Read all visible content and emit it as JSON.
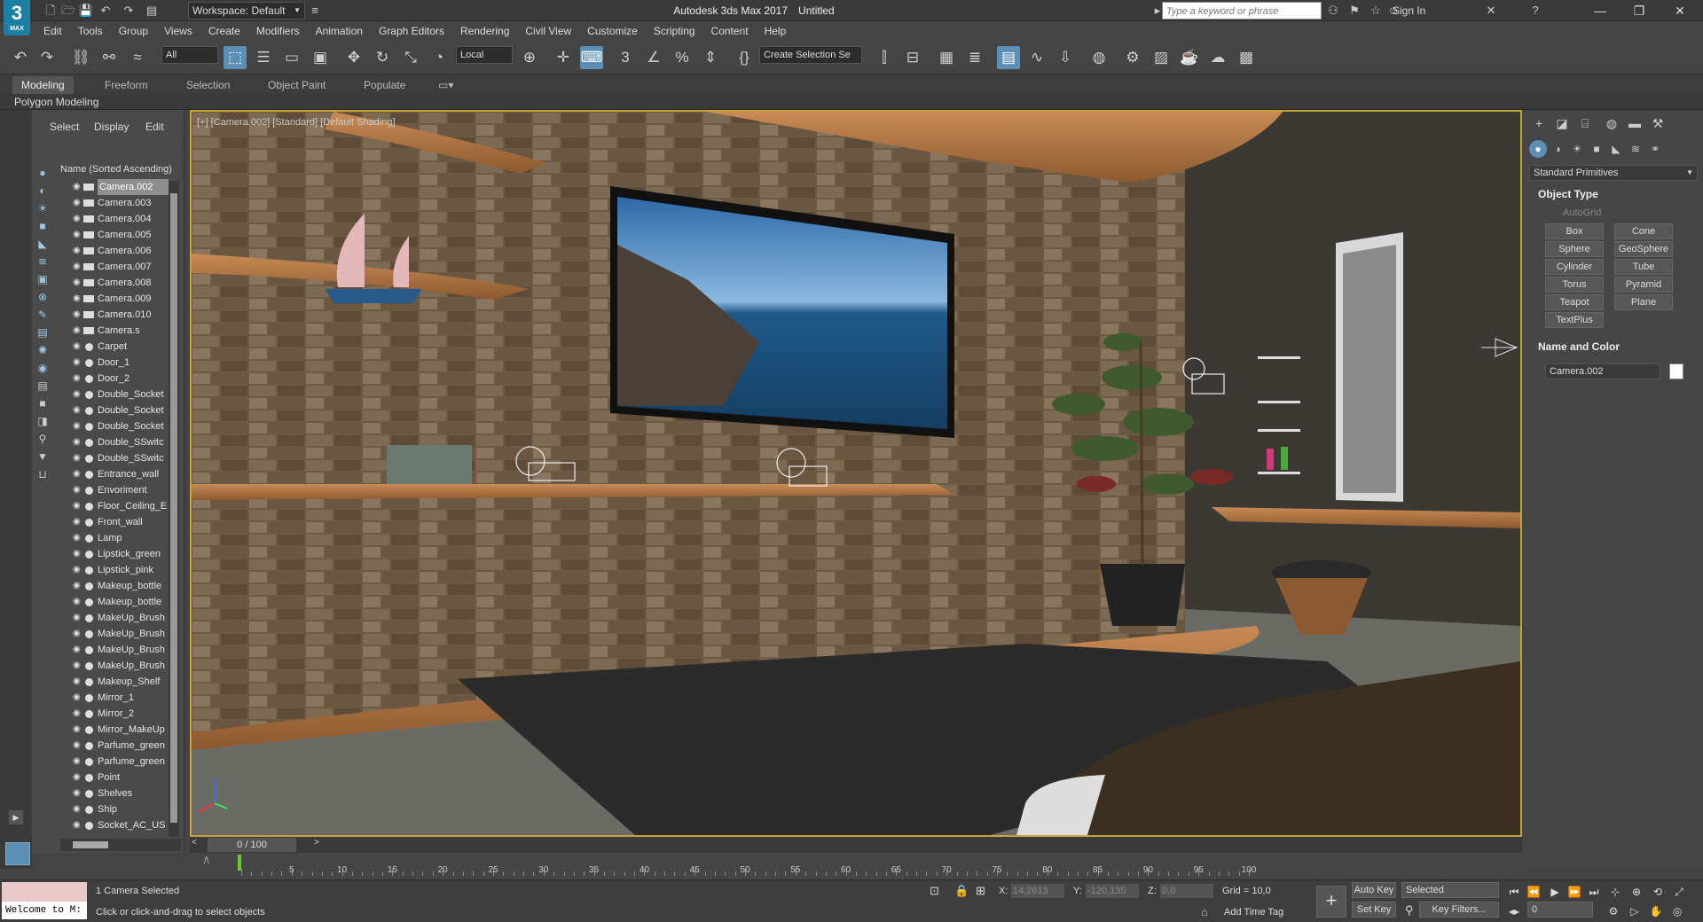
{
  "app": {
    "logo_text": "3",
    "logo_sub": "MAX",
    "title": "Autodesk 3ds Max 2017",
    "doc": "Untitled"
  },
  "workspace": {
    "label": "Workspace: Default"
  },
  "search": {
    "placeholder": "Type a keyword or phrase"
  },
  "account": {
    "signin": "Sign In"
  },
  "menus": [
    "Edit",
    "Tools",
    "Group",
    "Views",
    "Create",
    "Modifiers",
    "Animation",
    "Graph Editors",
    "Rendering",
    "Civil View",
    "Customize",
    "Scripting",
    "Content",
    "Help"
  ],
  "toolbar": {
    "filter": "All",
    "coord": "Local",
    "selection_set": "Create Selection Se"
  },
  "ribbon": {
    "tabs": [
      "Modeling",
      "Freeform",
      "Selection",
      "Object Paint",
      "Populate"
    ],
    "sub": "Polygon Modeling"
  },
  "scene_explorer": {
    "tabs": [
      "Select",
      "Display",
      "Edit"
    ],
    "header": "Name (Sorted Ascending)",
    "items": [
      {
        "name": "Camera.002",
        "type": "camera",
        "selected": true
      },
      {
        "name": "Camera.003",
        "type": "camera"
      },
      {
        "name": "Camera.004",
        "type": "camera"
      },
      {
        "name": "Camera.005",
        "type": "camera"
      },
      {
        "name": "Camera.006",
        "type": "camera"
      },
      {
        "name": "Camera.007",
        "type": "camera"
      },
      {
        "name": "Camera.008",
        "type": "camera"
      },
      {
        "name": "Camera.009",
        "type": "camera"
      },
      {
        "name": "Camera.010",
        "type": "camera"
      },
      {
        "name": "Camera.s",
        "type": "camera"
      },
      {
        "name": "Carpet",
        "type": "object"
      },
      {
        "name": "Door_1",
        "type": "object"
      },
      {
        "name": "Door_2",
        "type": "object"
      },
      {
        "name": "Double_Socket",
        "type": "object"
      },
      {
        "name": "Double_Socket",
        "type": "object"
      },
      {
        "name": "Double_Socket",
        "type": "object"
      },
      {
        "name": "Double_SSwitc",
        "type": "object"
      },
      {
        "name": "Double_SSwitc",
        "type": "object"
      },
      {
        "name": "Entrance_wall",
        "type": "object"
      },
      {
        "name": "Envoriment",
        "type": "object"
      },
      {
        "name": "Floor_Ceiling_E",
        "type": "object"
      },
      {
        "name": "Front_wall",
        "type": "object"
      },
      {
        "name": "Lamp",
        "type": "object"
      },
      {
        "name": "Lipstick_green",
        "type": "object"
      },
      {
        "name": "Lipstick_pink",
        "type": "object"
      },
      {
        "name": "Makeup_bottle",
        "type": "object"
      },
      {
        "name": "Makeup_bottle",
        "type": "object"
      },
      {
        "name": "MakeUp_Brush",
        "type": "object"
      },
      {
        "name": "MakeUp_Brush",
        "type": "object"
      },
      {
        "name": "MakeUp_Brush",
        "type": "object"
      },
      {
        "name": "MakeUp_Brush",
        "type": "object"
      },
      {
        "name": "Makeup_Shelf",
        "type": "object"
      },
      {
        "name": "Mirror_1",
        "type": "object"
      },
      {
        "name": "Mirror_2",
        "type": "object"
      },
      {
        "name": "Mirror_MakeUp",
        "type": "object"
      },
      {
        "name": "Parfume_green",
        "type": "object"
      },
      {
        "name": "Parfume_green",
        "type": "object"
      },
      {
        "name": "Point",
        "type": "light"
      },
      {
        "name": "Shelves",
        "type": "object"
      },
      {
        "name": "Ship",
        "type": "object"
      },
      {
        "name": "Socket_AC_US",
        "type": "object"
      }
    ]
  },
  "viewport": {
    "label": "[+] [Camera.002] [Standard] [Default Shading]"
  },
  "command_panel": {
    "category": "Standard Primitives",
    "object_type_title": "Object Type",
    "autogrid": "AutoGrid",
    "buttons": [
      "Box",
      "Cone",
      "Sphere",
      "GeoSphere",
      "Cylinder",
      "Tube",
      "Torus",
      "Pyramid",
      "Teapot",
      "Plane",
      "TextPlus"
    ],
    "name_color_title": "Name and Color",
    "name_value": "Camera.002"
  },
  "time_slider": {
    "label": "0 / 100"
  },
  "trackbar": {
    "ticks": [
      "5",
      "10",
      "15",
      "20",
      "25",
      "30",
      "35",
      "40",
      "45",
      "50",
      "55",
      "60",
      "65",
      "70",
      "75",
      "80",
      "85",
      "90",
      "95",
      "100"
    ]
  },
  "status": {
    "maxscript": "Welcome to M:",
    "selection": "1 Camera Selected",
    "prompt": "Click or click-and-drag to select objects",
    "x_label": "X:",
    "x": "14,2613",
    "y_label": "Y:",
    "y": "-120,135",
    "z_label": "Z:",
    "z": "0,0",
    "grid": "Grid = 10,0",
    "add_time_tag": "Add Time Tag",
    "auto_key": "Auto Key",
    "set_key": "Set Key",
    "key_mode": "Selected",
    "key_filters": "Key Filters...",
    "frame": "0"
  }
}
